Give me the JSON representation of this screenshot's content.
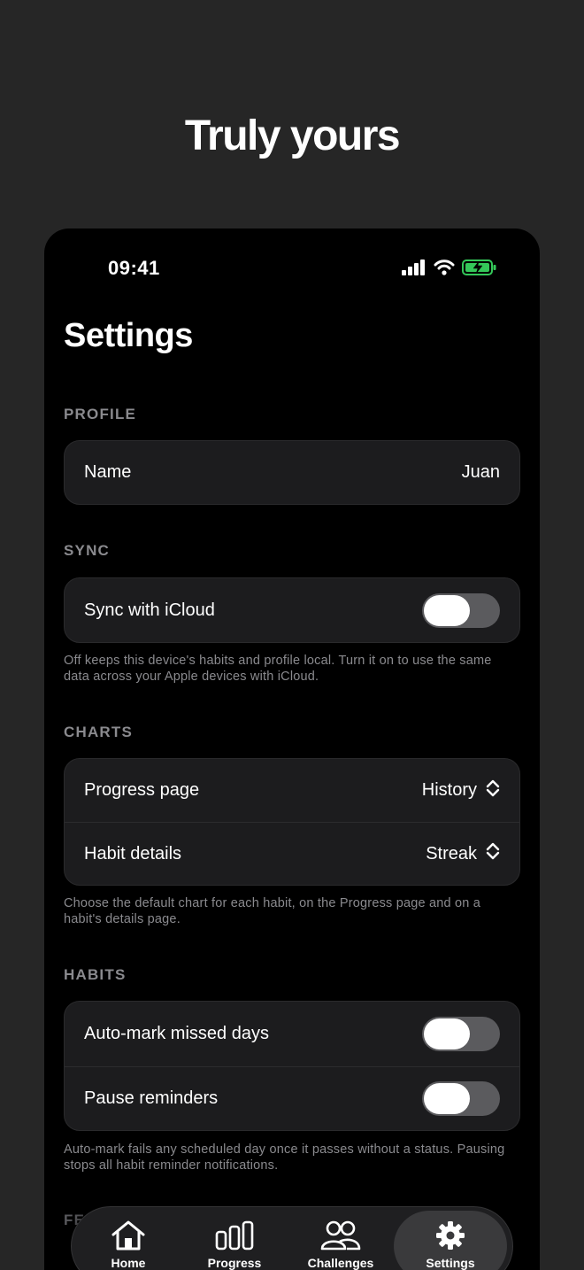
{
  "hero": {
    "title": "Truly yours"
  },
  "status_bar": {
    "time": "09:41"
  },
  "page": {
    "title": "Settings"
  },
  "profile": {
    "section_label": "PROFILE",
    "name_label": "Name",
    "name_value": "Juan"
  },
  "sync": {
    "section_label": "SYNC",
    "icloud_label": "Sync with iCloud",
    "icloud_on": false,
    "footnote": "Off keeps this device's habits and profile local. Turn it on to use the same data across your Apple devices with iCloud."
  },
  "charts": {
    "section_label": "CHARTS",
    "progress_label": "Progress page",
    "progress_value": "History",
    "details_label": "Habit details",
    "details_value": "Streak",
    "footnote": "Choose the default chart for each habit, on the Progress page and on a habit's details page."
  },
  "habits": {
    "section_label": "HABITS",
    "automark_label": "Auto-mark missed days",
    "automark_on": false,
    "pause_label": "Pause reminders",
    "pause_on": false,
    "footnote": "Auto-mark fails any scheduled day once it passes without a status. Pausing stops all habit reminder notifications."
  },
  "next_section": {
    "label": "FEEDBACK"
  },
  "tab_bar": {
    "tabs": [
      {
        "label": "Home",
        "icon": "house-icon"
      },
      {
        "label": "Progress",
        "icon": "bars-icon"
      },
      {
        "label": "Challenges",
        "icon": "people-icon"
      },
      {
        "label": "Settings",
        "icon": "gear-icon"
      }
    ],
    "active": "Settings"
  },
  "colors": {
    "background": "#262626",
    "phone": "#000000",
    "card": "#1c1c1e",
    "secondary_text": "#8a8a8e",
    "toggle_off": "#5b5b5e",
    "battery": "#34c759"
  }
}
